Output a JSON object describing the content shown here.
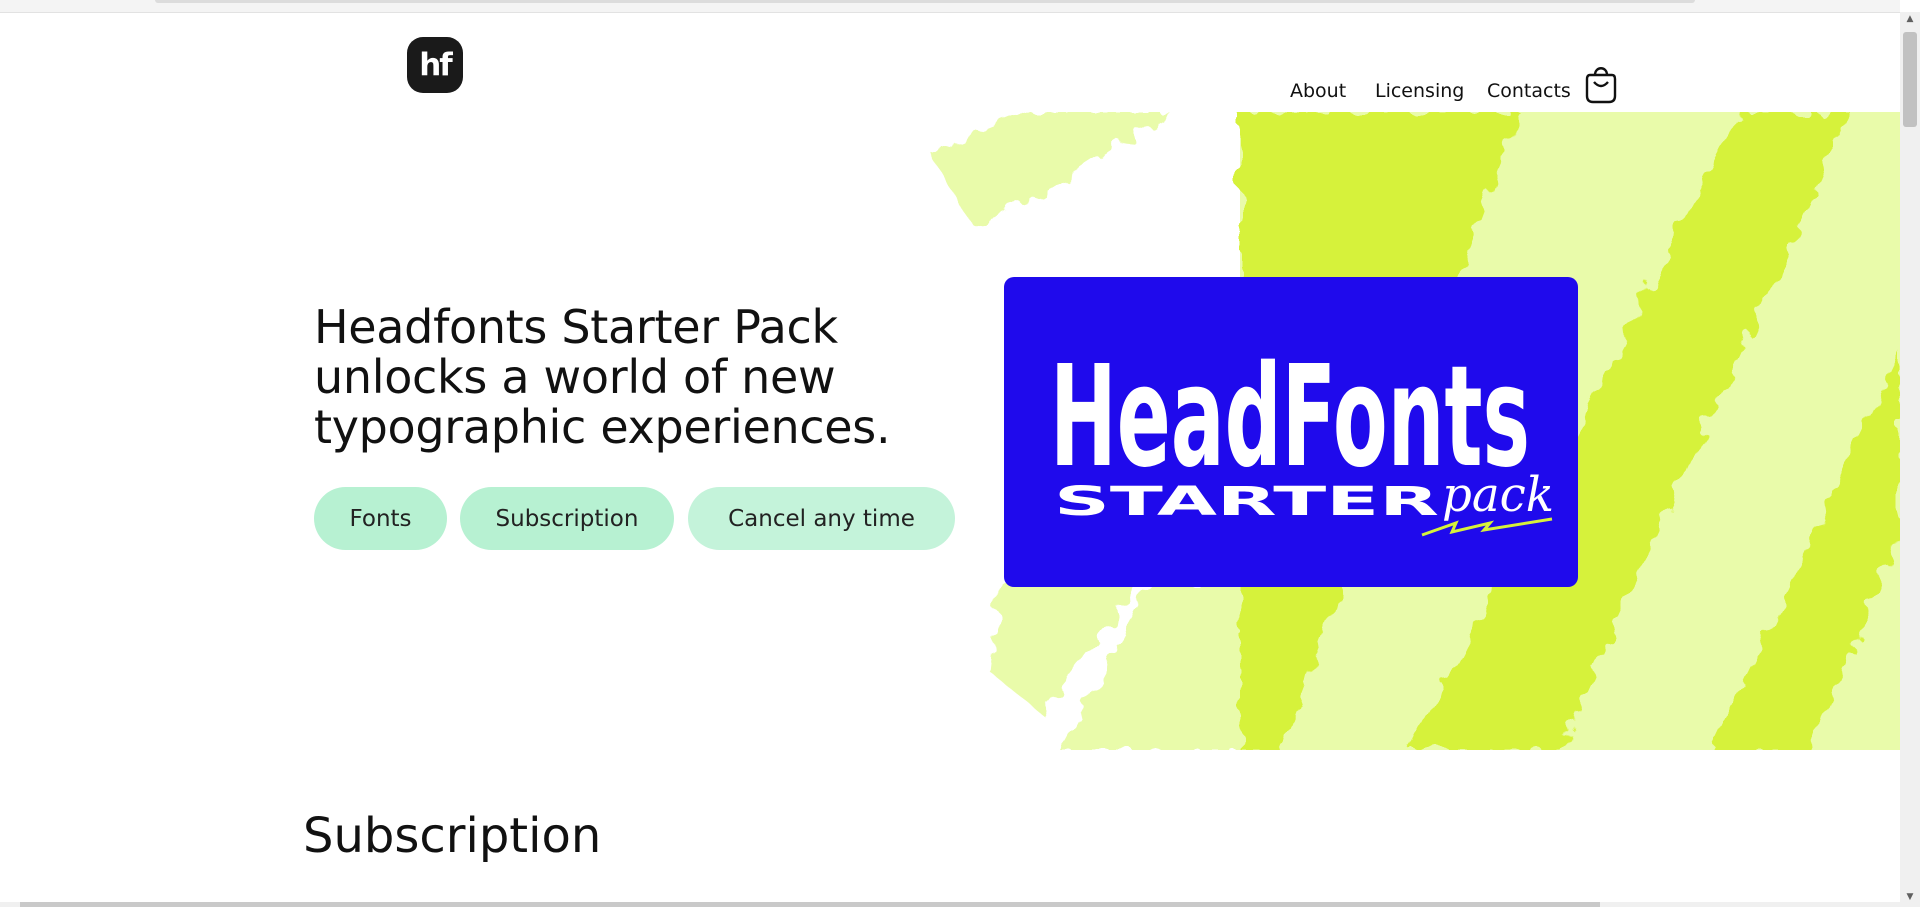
{
  "header": {
    "logo_text": "hf",
    "nav": [
      {
        "label": "About"
      },
      {
        "label": "Licensing"
      },
      {
        "label": "Contacts"
      }
    ],
    "cart_icon": "shopping-bag-icon"
  },
  "hero": {
    "headline_lines": [
      "Headfonts Starter Pack",
      "unlocks a world of new",
      "typographic experiences."
    ],
    "chips": [
      {
        "label": "Fonts"
      },
      {
        "label": "Subscription"
      },
      {
        "label": "Cancel any time"
      }
    ],
    "promo": {
      "brand": "HeadFonts",
      "line1": "STARTER",
      "line2": "pack"
    }
  },
  "sections": {
    "subscription_title": "Subscription"
  },
  "colors": {
    "promo_blue": "#1f0aec",
    "chip_green": "#b7f1d2",
    "lime": "#d6f23a",
    "lime_light": "#e9fbaa"
  }
}
